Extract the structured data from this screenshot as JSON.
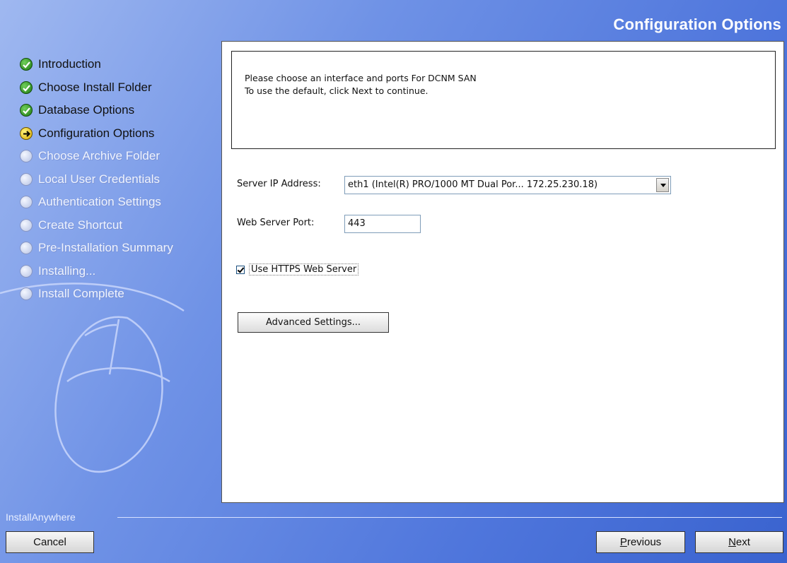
{
  "header": {
    "title": "Configuration Options"
  },
  "steps": [
    {
      "label": "Introduction",
      "state": "done"
    },
    {
      "label": "Choose Install Folder",
      "state": "done"
    },
    {
      "label": "Database Options",
      "state": "done"
    },
    {
      "label": "Configuration Options",
      "state": "current"
    },
    {
      "label": "Choose Archive Folder",
      "state": "pending"
    },
    {
      "label": "Local User Credentials",
      "state": "pending"
    },
    {
      "label": "Authentication Settings",
      "state": "pending"
    },
    {
      "label": "Create Shortcut",
      "state": "pending"
    },
    {
      "label": "Pre-Installation Summary",
      "state": "pending"
    },
    {
      "label": "Installing...",
      "state": "pending"
    },
    {
      "label": "Install Complete",
      "state": "pending"
    }
  ],
  "main": {
    "message_line1": "Please choose an interface and ports For DCNM SAN",
    "message_line2": "To use the default, click Next to continue.",
    "server_ip_label": "Server IP Address:",
    "server_ip_value": "eth1 (Intel(R) PRO/1000 MT Dual Por... 172.25.230.18)",
    "web_port_label": "Web Server Port:",
    "web_port_value": "443",
    "https_label": "Use HTTPS Web Server",
    "https_checked": true,
    "advanced_label": "Advanced Settings..."
  },
  "footer": {
    "brand": "InstallAnywhere",
    "cancel_label": "Cancel",
    "previous_mnemonic": "P",
    "previous_rest": "revious",
    "next_mnemonic": "N",
    "next_rest": "ext"
  },
  "icons": {
    "done": "check-circle-icon",
    "current": "arrow-circle-icon",
    "pending": "empty-circle-icon"
  }
}
